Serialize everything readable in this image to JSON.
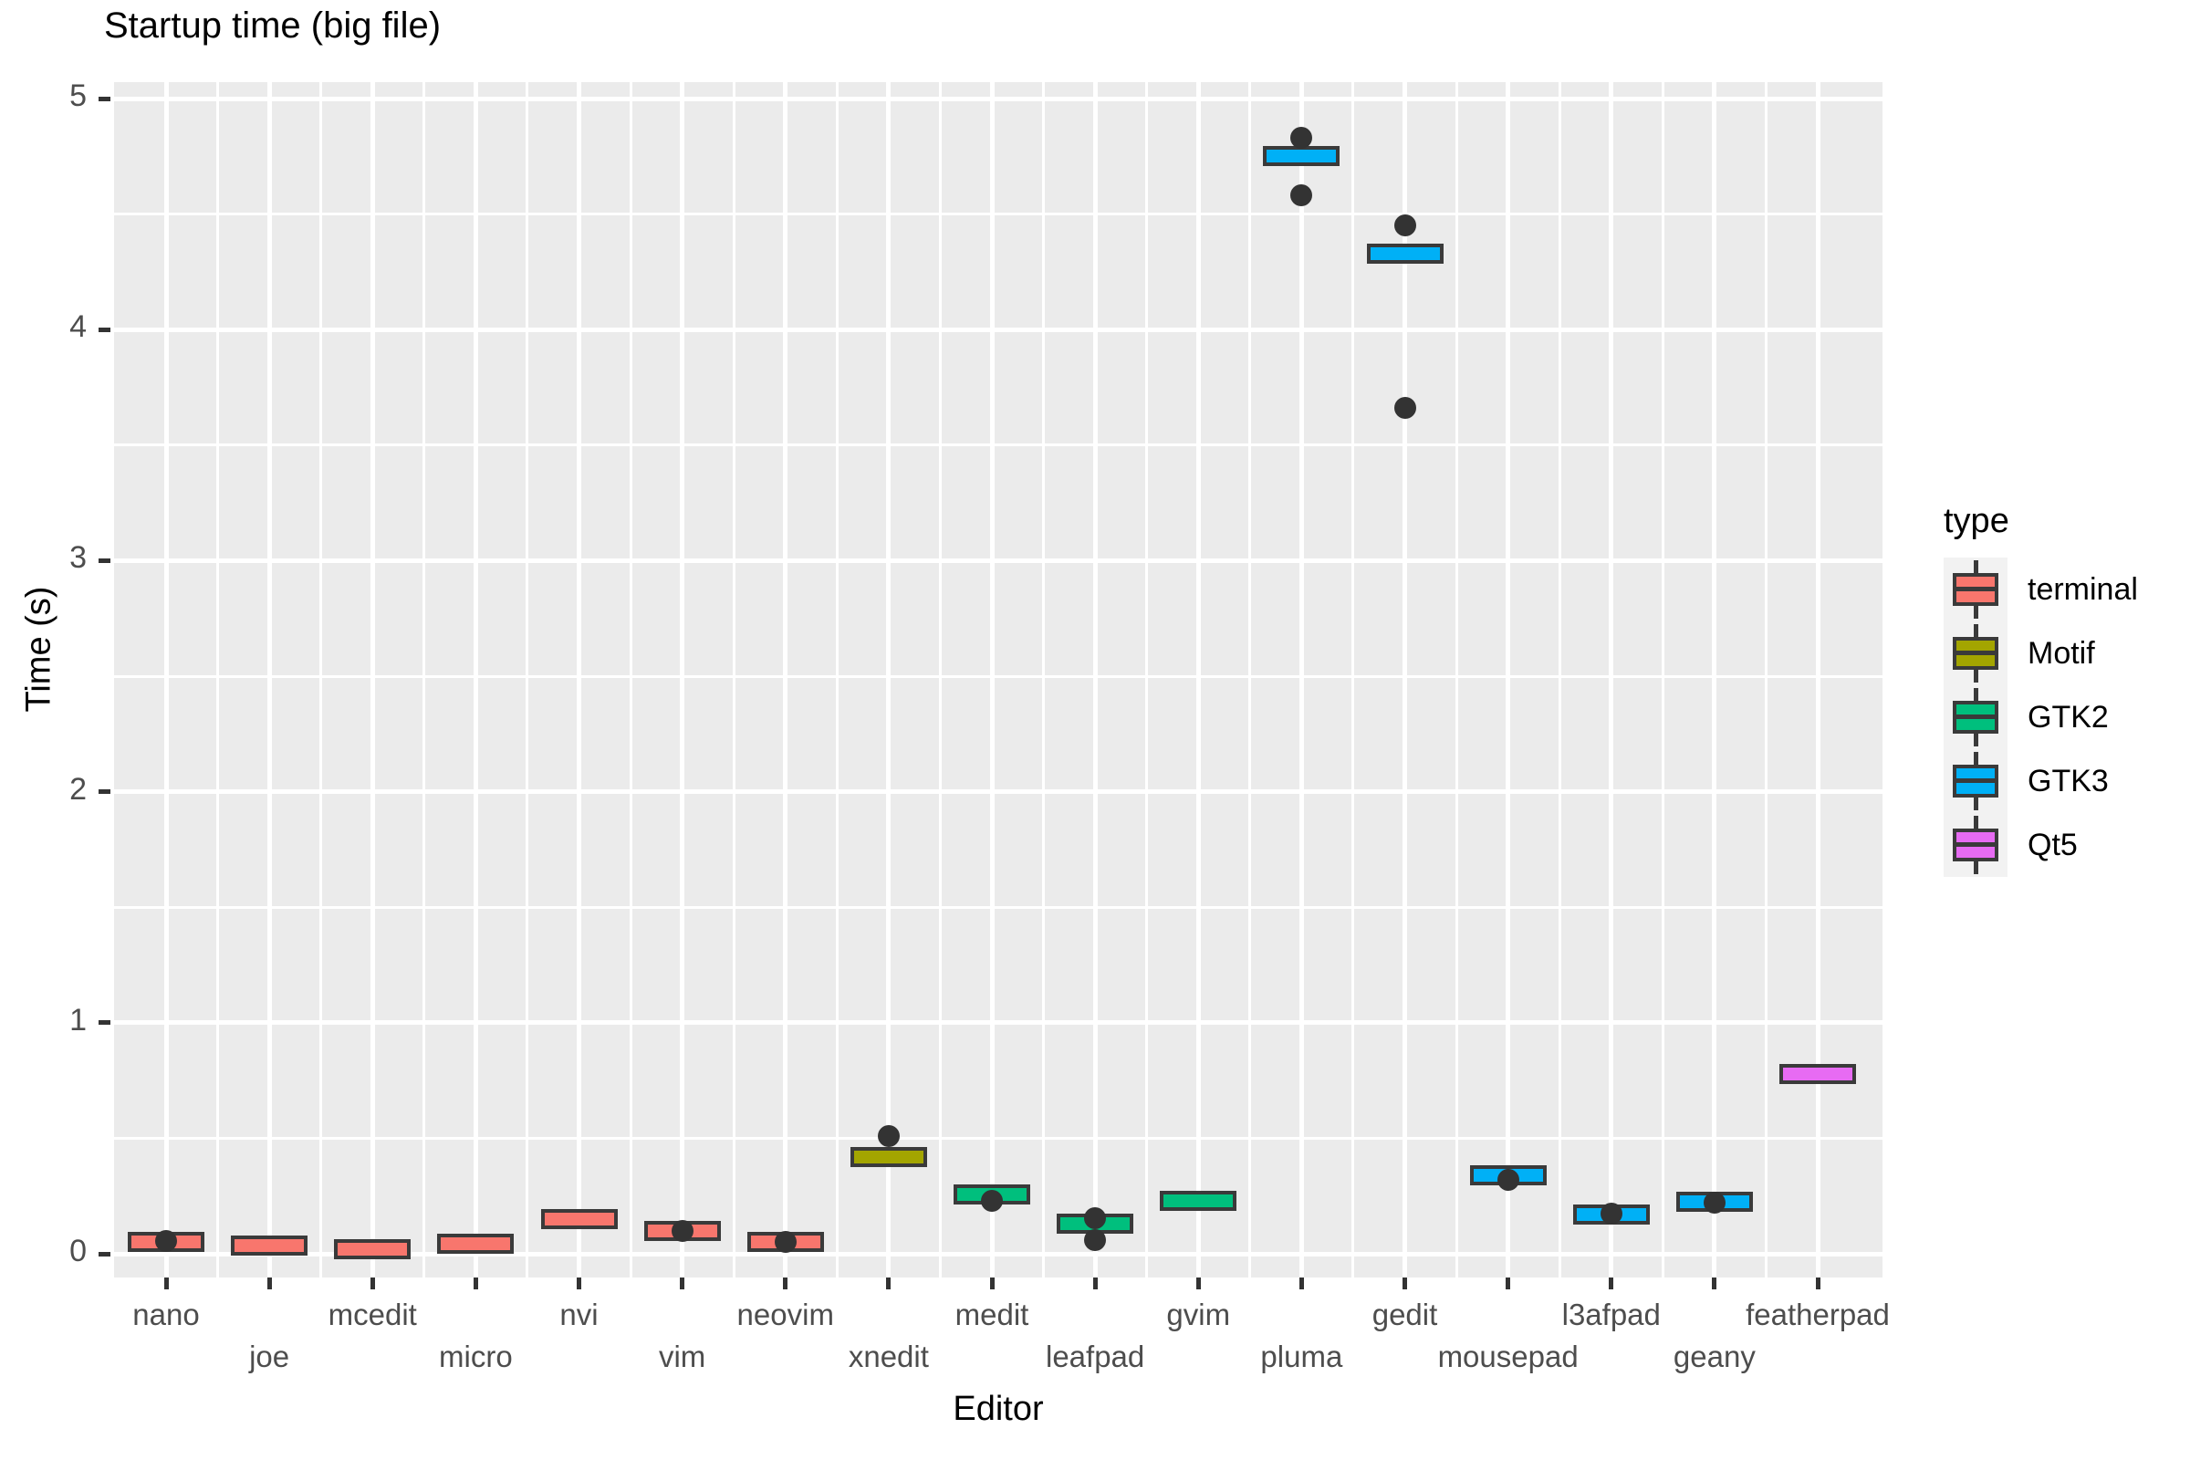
{
  "chart": {
    "title": "Startup time (big file)",
    "xlabel": "Editor",
    "ylabel": "Time (s)"
  },
  "legend": {
    "title": "type",
    "items": [
      {
        "label": "terminal",
        "color": "#F8766D"
      },
      {
        "label": "Motif",
        "color": "#A3A500"
      },
      {
        "label": "GTK2",
        "color": "#00BF7D"
      },
      {
        "label": "GTK3",
        "color": "#00B0F6"
      },
      {
        "label": "Qt5",
        "color": "#E76BF3"
      }
    ]
  },
  "axes": {
    "y_ticks": [
      "0",
      "1",
      "2",
      "3",
      "4",
      "5"
    ],
    "y_values": [
      0,
      1,
      2,
      3,
      4,
      5
    ],
    "ylim": [
      -0.26,
      5.15
    ],
    "x_ticks": [
      "nano",
      "joe",
      "mcedit",
      "micro",
      "nvi",
      "vim",
      "neovim",
      "xnedit",
      "medit",
      "leafpad",
      "gvim",
      "pluma",
      "gedit",
      "mousepad",
      "l3afpad",
      "geany",
      "featherpad"
    ]
  },
  "chart_data": {
    "type": "box",
    "title": "Startup time (big file)",
    "xlabel": "Editor",
    "ylabel": "Time (s)",
    "ylim": [
      0,
      5
    ],
    "grid": true,
    "legend_position": "right",
    "legend_title": "type",
    "categories": [
      "nano",
      "joe",
      "mcedit",
      "micro",
      "nvi",
      "vim",
      "neovim",
      "xnedit",
      "medit",
      "leafpad",
      "gvim",
      "pluma",
      "gedit",
      "mousepad",
      "l3afpad",
      "geany",
      "featherpad"
    ],
    "series": [
      {
        "name": "terminal",
        "color": "#F8766D",
        "categories": [
          "nano",
          "joe",
          "mcedit",
          "micro",
          "nvi",
          "vim",
          "neovim"
        ]
      },
      {
        "name": "Motif",
        "color": "#A3A500",
        "categories": [
          "xnedit"
        ]
      },
      {
        "name": "GTK2",
        "color": "#00BF7D",
        "categories": [
          "medit",
          "leafpad",
          "gvim"
        ]
      },
      {
        "name": "GTK3",
        "color": "#00B0F6",
        "categories": [
          "pluma",
          "gedit",
          "mousepad",
          "l3afpad",
          "geany"
        ]
      },
      {
        "name": "Qt5",
        "color": "#E76BF3",
        "categories": [
          "featherpad"
        ]
      }
    ],
    "boxes": [
      {
        "category": "nano",
        "type": "terminal",
        "lower": 0.04,
        "q1": 0.045,
        "median": 0.05,
        "q3": 0.055,
        "upper": 0.06,
        "outliers": [
          0.055
        ]
      },
      {
        "category": "joe",
        "type": "terminal",
        "lower": 0.025,
        "q1": 0.03,
        "median": 0.035,
        "q3": 0.04,
        "upper": 0.045,
        "outliers": []
      },
      {
        "category": "mcedit",
        "type": "terminal",
        "lower": 0.015,
        "q1": 0.018,
        "median": 0.02,
        "q3": 0.023,
        "upper": 0.026,
        "outliers": []
      },
      {
        "category": "micro",
        "type": "terminal",
        "lower": 0.035,
        "q1": 0.04,
        "median": 0.045,
        "q3": 0.05,
        "upper": 0.055,
        "outliers": []
      },
      {
        "category": "nvi",
        "type": "terminal",
        "lower": 0.14,
        "q1": 0.145,
        "median": 0.15,
        "q3": 0.155,
        "upper": 0.16,
        "outliers": []
      },
      {
        "category": "vim",
        "type": "terminal",
        "lower": 0.09,
        "q1": 0.095,
        "median": 0.1,
        "q3": 0.105,
        "upper": 0.11,
        "outliers": [
          0.1
        ]
      },
      {
        "category": "neovim",
        "type": "terminal",
        "lower": 0.04,
        "q1": 0.045,
        "median": 0.05,
        "q3": 0.055,
        "upper": 0.06,
        "outliers": [
          0.05
        ]
      },
      {
        "category": "xnedit",
        "type": "Motif",
        "lower": 0.4,
        "q1": 0.41,
        "median": 0.42,
        "q3": 0.43,
        "upper": 0.44,
        "outliers": [
          0.51
        ]
      },
      {
        "category": "medit",
        "type": "GTK2",
        "lower": 0.24,
        "q1": 0.25,
        "median": 0.255,
        "q3": 0.26,
        "upper": 0.27,
        "outliers": [
          0.23
        ]
      },
      {
        "category": "leafpad",
        "type": "GTK2",
        "lower": 0.12,
        "q1": 0.125,
        "median": 0.13,
        "q3": 0.14,
        "upper": 0.145,
        "outliers": [
          0.155,
          0.06
        ]
      },
      {
        "category": "gvim",
        "type": "GTK2",
        "lower": 0.22,
        "q1": 0.225,
        "median": 0.23,
        "q3": 0.24,
        "upper": 0.245,
        "outliers": []
      },
      {
        "category": "pluma",
        "type": "GTK3",
        "lower": 4.73,
        "q1": 4.74,
        "median": 4.75,
        "q3": 4.76,
        "upper": 4.77,
        "outliers": [
          4.83,
          4.58
        ]
      },
      {
        "category": "gedit",
        "type": "GTK3",
        "lower": 4.3,
        "q1": 4.31,
        "median": 4.33,
        "q3": 4.34,
        "upper": 4.35,
        "outliers": [
          4.45,
          3.66
        ]
      },
      {
        "category": "mousepad",
        "type": "GTK3",
        "lower": 0.33,
        "q1": 0.335,
        "median": 0.34,
        "q3": 0.345,
        "upper": 0.35,
        "outliers": [
          0.32
        ]
      },
      {
        "category": "l3afpad",
        "type": "GTK3",
        "lower": 0.16,
        "q1": 0.165,
        "median": 0.17,
        "q3": 0.175,
        "upper": 0.18,
        "outliers": [
          0.175
        ]
      },
      {
        "category": "geany",
        "type": "GTK3",
        "lower": 0.215,
        "q1": 0.22,
        "median": 0.225,
        "q3": 0.23,
        "upper": 0.235,
        "outliers": [
          0.22
        ]
      },
      {
        "category": "featherpad",
        "type": "Qt5",
        "lower": 0.77,
        "q1": 0.775,
        "median": 0.78,
        "q3": 0.785,
        "upper": 0.79,
        "outliers": []
      }
    ]
  }
}
